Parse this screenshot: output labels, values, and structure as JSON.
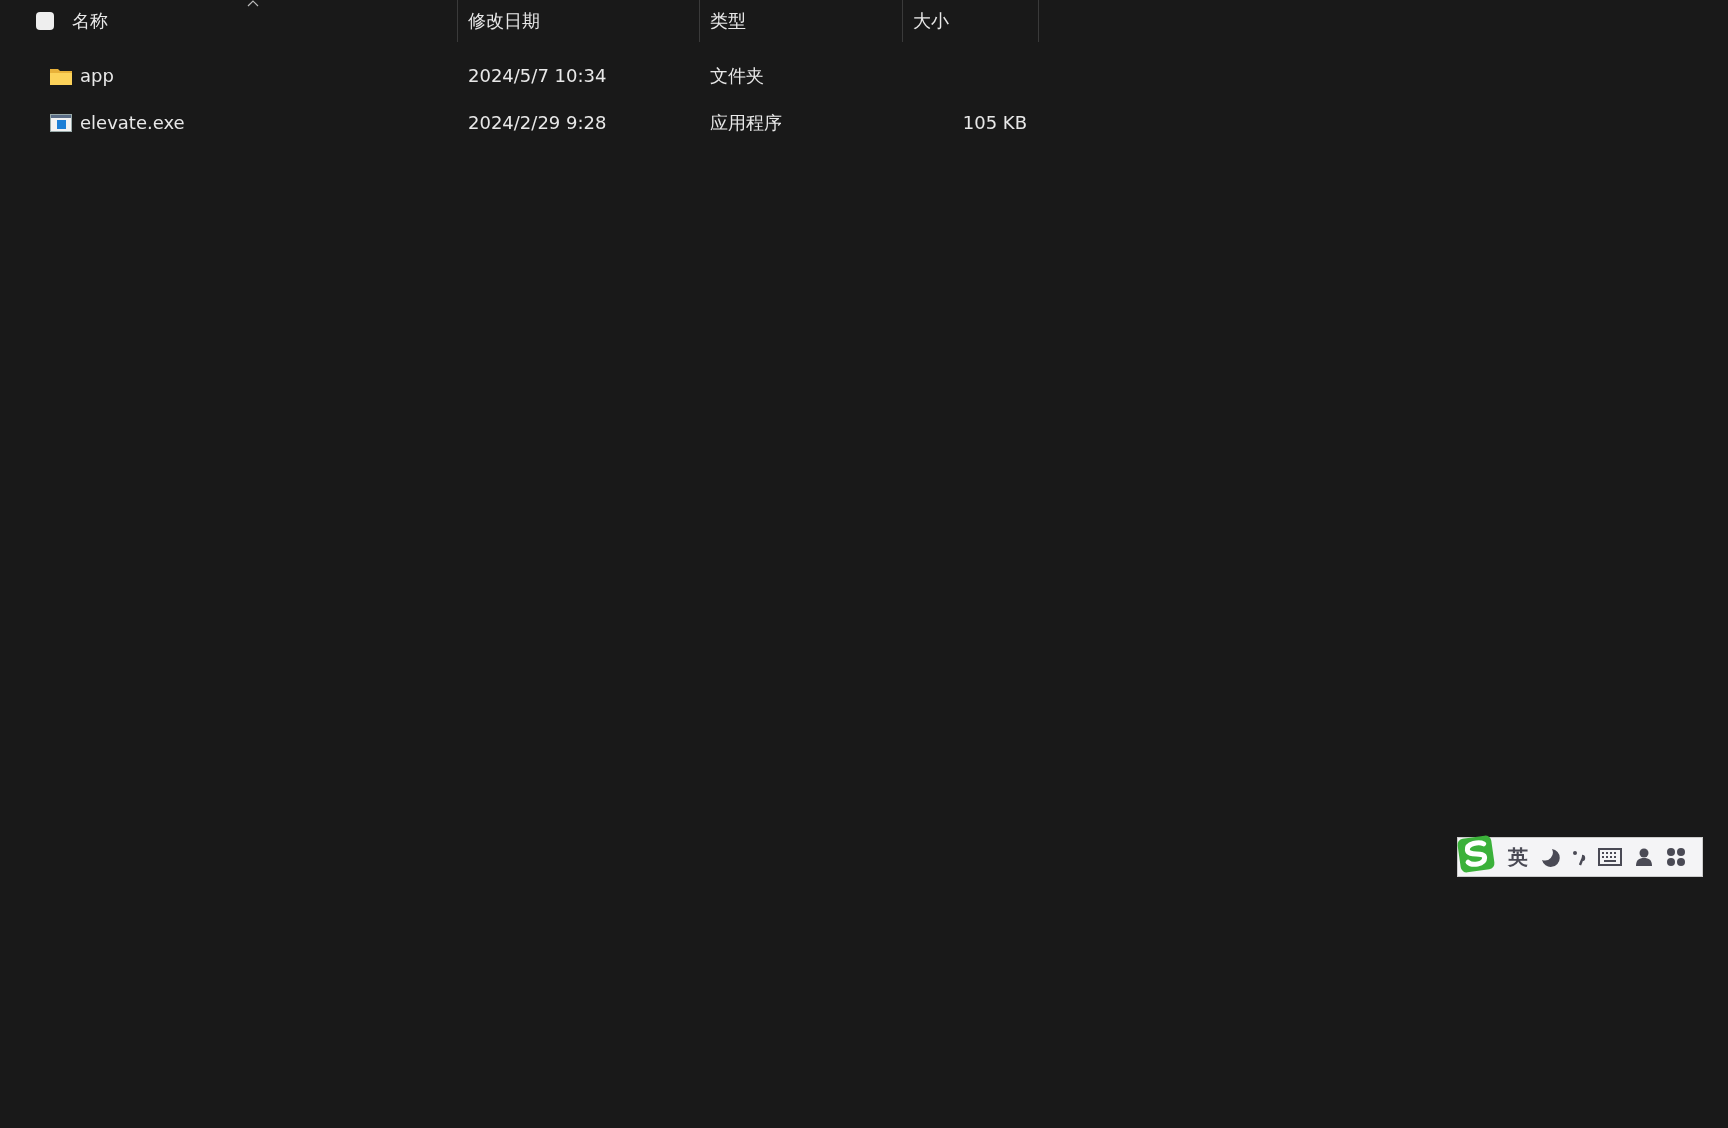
{
  "header": {
    "select_all": {
      "checked": false
    },
    "columns": [
      {
        "label": "名称",
        "sorted": true
      },
      {
        "label": "修改日期",
        "sorted": false
      },
      {
        "label": "类型",
        "sorted": false
      },
      {
        "label": "大小",
        "sorted": false
      }
    ]
  },
  "rows": [
    {
      "kind": "folder",
      "name": "app",
      "modified": "2024/5/7 10:34",
      "type": "文件夹"
    },
    {
      "kind": "exe",
      "name": "elevate.exe",
      "modified": "2024/2/29 9:28",
      "type": "应用程序",
      "size": "105 KB"
    }
  ],
  "ime_toolbar": {
    "mode": "英"
  }
}
